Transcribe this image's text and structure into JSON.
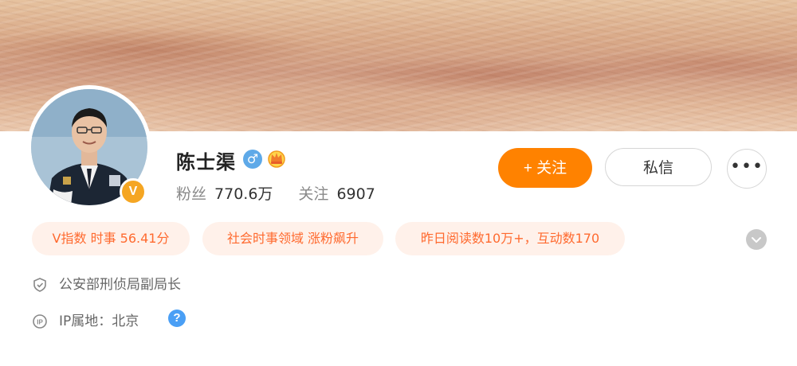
{
  "profile": {
    "name": "陈士渠",
    "gender_icon": "male-icon",
    "gender_glyph": "♂",
    "vip_icon": "crown-icon",
    "verified_badge": "V",
    "fans_label": "粉丝",
    "fans_value": "770.6万",
    "following_label": "关注",
    "following_value": "6907"
  },
  "actions": {
    "follow_label": "+ 关注",
    "message_label": "私信",
    "more_glyph": "•••"
  },
  "tags": [
    "V指数 时事 56.41分",
    "社会时事领域 涨粉飙升",
    "昨日阅读数10万+，互动数170"
  ],
  "info": {
    "title": "公安部刑侦局副局长",
    "ip_label": "IP属地：北京",
    "help_glyph": "?"
  },
  "colors": {
    "accent": "#ff8200",
    "tag_bg": "#fff1ea",
    "tag_text": "#ff6a2f",
    "verified": "#f5a623",
    "help": "#4a9ff5",
    "gender": "#5ea9e8"
  }
}
